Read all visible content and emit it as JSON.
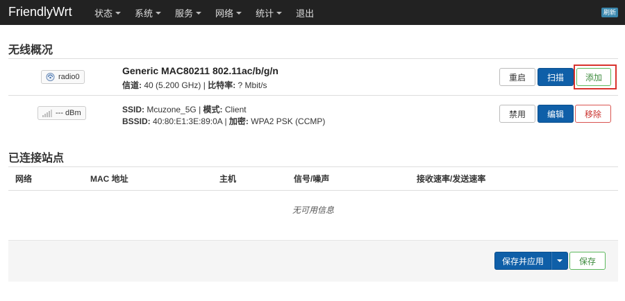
{
  "navbar": {
    "brand": "FriendlyWrt",
    "menu": [
      {
        "label": "状态",
        "has_caret": true
      },
      {
        "label": "系统",
        "has_caret": true
      },
      {
        "label": "服务",
        "has_caret": true
      },
      {
        "label": "网络",
        "has_caret": true
      },
      {
        "label": "统计",
        "has_caret": true
      },
      {
        "label": "退出",
        "has_caret": false
      }
    ],
    "refresh_label": "刷新"
  },
  "overview": {
    "title": "无线概况",
    "radio": {
      "badge_label": "radio0",
      "name": "Generic MAC80211 802.11ac/b/g/n",
      "channel_label": "信道:",
      "channel_value": "40 (5.200 GHz)",
      "bitrate_label": "比特率:",
      "bitrate_value": "? Mbit/s",
      "buttons": {
        "restart": "重启",
        "scan": "扫描",
        "add": "添加"
      }
    },
    "network": {
      "badge_label": "--- dBm",
      "ssid_label": "SSID:",
      "ssid_value": "Mcuzone_5G",
      "mode_label": "模式:",
      "mode_value": "Client",
      "bssid_label": "BSSID:",
      "bssid_value": "40:80:E1:3E:89:0A",
      "encryption_label": "加密:",
      "encryption_value": "WPA2 PSK (CCMP)",
      "buttons": {
        "disable": "禁用",
        "edit": "编辑",
        "remove": "移除"
      }
    }
  },
  "stations": {
    "title": "已连接站点",
    "columns": [
      "网络",
      "MAC 地址",
      "主机",
      "信号/噪声",
      "接收速率/发送速率"
    ],
    "empty_message": "无可用信息"
  },
  "footer": {
    "save_apply_label": "保存并应用",
    "save_label": "保存"
  },
  "colors": {
    "navbar": "#222222",
    "primary": "#0f5fa8",
    "success": "#5cb85c",
    "danger": "#d9534f",
    "highlight": "#d9322d"
  }
}
